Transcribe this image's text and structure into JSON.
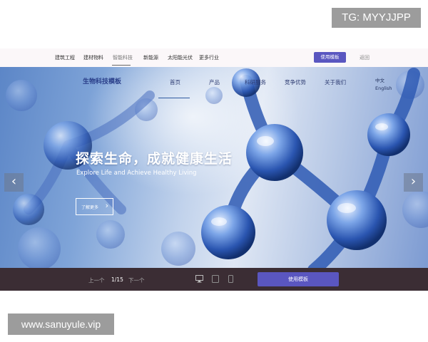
{
  "watermarks": {
    "top": "TG: MYYJJPP",
    "bottom": "www.sanuyule.vip"
  },
  "category_bar": {
    "items": [
      "建筑工程",
      "建材物料",
      "智能科技",
      "新能源",
      "太阳能光伏",
      "更多行业"
    ],
    "active_index": 2,
    "use_template_label": "使用模板",
    "back_label": "返回"
  },
  "hero": {
    "brand": "生物科技模板",
    "nav": [
      "首页",
      "产品",
      "科研服务",
      "竞争优势",
      "关于我们"
    ],
    "language": [
      "中文",
      "English"
    ],
    "title": "探索生命，成就健康生活",
    "subtitle": "Explore Life and Achieve Healthy Living",
    "learn_more_label": "了解更多",
    "prev_arrow": "‹",
    "next_arrow": "›"
  },
  "control_bar": {
    "prev_label": "上一个",
    "page_indicator": "1/15",
    "next_label": "下一个",
    "device_icons": [
      "desktop-icon",
      "tablet-icon",
      "mobile-icon"
    ],
    "use_template_label": "使用模板"
  },
  "colors": {
    "accent": "#5a56c0",
    "control_bar": "#3b2d34",
    "brand_text": "#2a3f8a"
  }
}
